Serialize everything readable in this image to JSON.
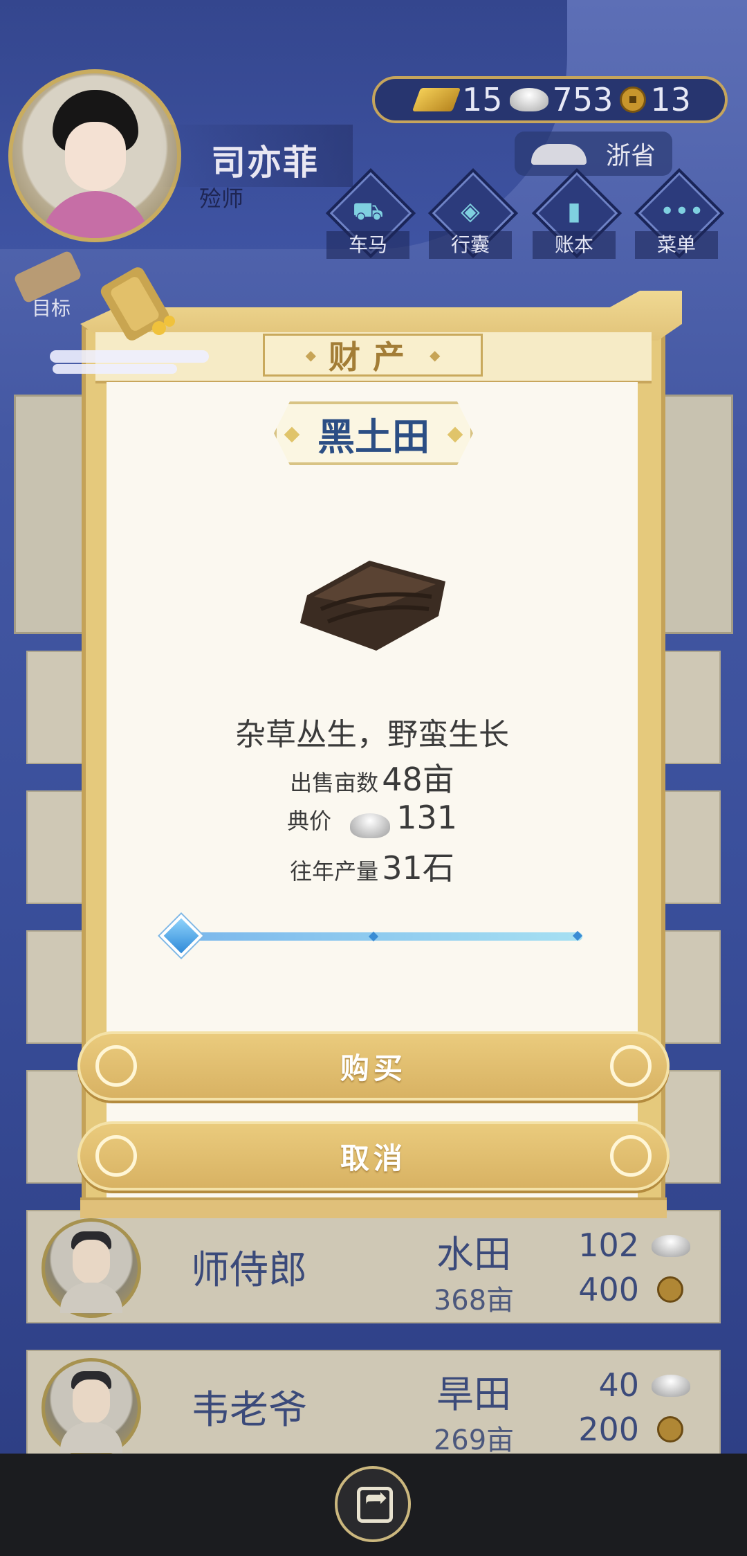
{
  "header": {
    "player_name": "司亦菲",
    "player_title": "殓师",
    "currency": {
      "gold": "15",
      "silver": "753",
      "copper": "13"
    },
    "province": "浙省",
    "nav": [
      {
        "label": "车马",
        "icon": "carriage-icon",
        "glyph": "⛟"
      },
      {
        "label": "行囊",
        "icon": "bag-icon",
        "glyph": "◈"
      },
      {
        "label": "账本",
        "icon": "ledger-icon",
        "glyph": "▮"
      },
      {
        "label": "菜单",
        "icon": "menu-icon",
        "glyph": "•••"
      }
    ],
    "goal_label": "目标"
  },
  "dialog": {
    "title": "财产",
    "item_name": "黑土田",
    "description": "杂草丛生，野蛮生长",
    "acres_label": "出售亩数",
    "acres_value": "48亩",
    "price_label": "典价",
    "price_value": "131",
    "yield_label": "往年产量",
    "yield_value": "31石",
    "slider_fraction": 0.0,
    "buy_label": "购买",
    "cancel_label": "取消"
  },
  "listings": [
    {
      "name": "师侍郎",
      "land_type": "水田",
      "acres": "368亩",
      "silver": "102",
      "copper": "400"
    },
    {
      "name": "韦老爷",
      "land_type": "旱田",
      "acres": "269亩",
      "silver": "40",
      "copper": "200"
    }
  ],
  "colors": {
    "accent_gold": "#d8b263",
    "title_blue": "#2b4e84",
    "slider_blue": "#2f8ad8"
  }
}
